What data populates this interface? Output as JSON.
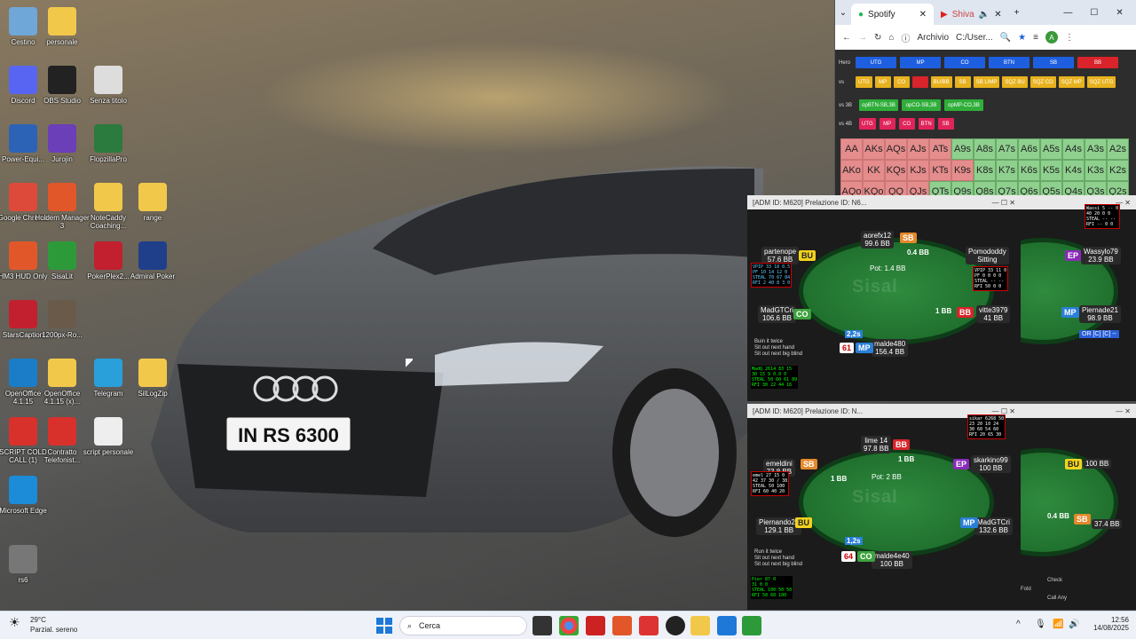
{
  "desktop": {
    "icons": [
      {
        "label": "Cestino",
        "icon": "recycle-bin-icon",
        "color": "#6fa7d8"
      },
      {
        "label": "personale",
        "icon": "folder-icon",
        "color": "#f2c84b"
      },
      {
        "label": "Discord",
        "icon": "discord-icon",
        "color": "#5865f2"
      },
      {
        "label": "OBS Studio",
        "icon": "obs-icon",
        "color": "#222"
      },
      {
        "label": "Senza titolo",
        "icon": "document-icon",
        "color": "#ddd"
      },
      {
        "label": "Power-Equi...",
        "icon": "power-equilab-icon",
        "color": "#2c63b7"
      },
      {
        "label": "Jurojin",
        "icon": "jurojin-icon",
        "color": "#6a3fb7"
      },
      {
        "label": "FlopzillaPro",
        "icon": "flopzilla-icon",
        "color": "#2b7a3e"
      },
      {
        "label": "Google Chrome",
        "icon": "chrome-icon",
        "color": "#dd4a3a"
      },
      {
        "label": "Holdem Manager 3",
        "icon": "holdem-manager-icon",
        "color": "#e2572a"
      },
      {
        "label": "NoteCaddy Coaching...",
        "icon": "folder-icon",
        "color": "#f2c84b"
      },
      {
        "label": "range",
        "icon": "folder-icon",
        "color": "#f2c84b"
      },
      {
        "label": "HM3 HUD Only",
        "icon": "hm3-hud-icon",
        "color": "#e2572a"
      },
      {
        "label": "SisaLit",
        "icon": "sisal-icon",
        "color": "#2d9a3a"
      },
      {
        "label": "PokerPlex2...",
        "icon": "pokerplex-icon",
        "color": "#c21f2f"
      },
      {
        "label": "Admiral Poker",
        "icon": "admiral-poker-icon",
        "color": "#1f3f8a"
      },
      {
        "label": "StarsCaption",
        "icon": "stars-icon",
        "color": "#c21f2f"
      },
      {
        "label": "1200px-Ro...",
        "icon": "image-icon",
        "color": "#6a5a4a"
      },
      {
        "label": "OpenOffice 4.1.15",
        "icon": "openoffice-icon",
        "color": "#1b7dc8"
      },
      {
        "label": "OpenOffice 4.1.15 (x)...",
        "icon": "folder-icon",
        "color": "#f2c84b"
      },
      {
        "label": "Telegram",
        "icon": "telegram-icon",
        "color": "#29a0da"
      },
      {
        "label": "SilLogZip",
        "icon": "folder-icon",
        "color": "#f2c84b"
      },
      {
        "label": "SCRIPT COLD CALL (1)",
        "icon": "pdf-icon",
        "color": "#d8312c"
      },
      {
        "label": "Contratto Telefonist...",
        "icon": "pdf-icon",
        "color": "#d8312c"
      },
      {
        "label": "script personale",
        "icon": "document-icon",
        "color": "#eee"
      },
      {
        "label": "Microsoft Edge",
        "icon": "edge-icon",
        "color": "#1c8bd8"
      },
      {
        "label": "rs6",
        "icon": "car-image-icon",
        "color": "#777"
      }
    ],
    "plate": "IN RS 6300"
  },
  "browser": {
    "tab_active": "Spotify",
    "tab_other": "Shiva",
    "address": "C:/User...",
    "archive_label": "Archivio",
    "rows": {
      "hero": "Hero",
      "vs": "vs",
      "vs3b": "vs 3B",
      "vs4b": "vs 4B",
      "hero_btns": [
        "UTG",
        "MP",
        "CO",
        "BTN",
        "SB",
        "BB"
      ],
      "vs_btns": [
        "UTG",
        "MP",
        "CO",
        "",
        "BU/BB",
        "SB",
        "SB LIMP",
        "SQZ BU",
        "SQZ CO",
        "SQZ MP",
        "SQZ UTG"
      ],
      "vs3b_btns": [
        "opBTN-SB,3B",
        "opCO-SB,3B",
        "opMP-CO,3B"
      ],
      "vs4b_btns": [
        "UTG",
        "MP",
        "CO",
        "BTN",
        "SB"
      ]
    },
    "grid": [
      [
        "AA",
        "AKs",
        "AQs",
        "AJs",
        "ATs",
        "A9s",
        "A8s",
        "A7s",
        "A6s",
        "A5s",
        "A4s",
        "A3s",
        "A2s"
      ],
      [
        "AKo",
        "KK",
        "KQs",
        "KJs",
        "KTs",
        "K9s",
        "K8s",
        "K7s",
        "K6s",
        "K5s",
        "K4s",
        "K3s",
        "K2s"
      ],
      [
        "AQo",
        "KQo",
        "QQ",
        "QJs",
        "QTs",
        "Q9s",
        "Q8s",
        "Q7s",
        "Q6s",
        "Q5s",
        "Q4s",
        "Q3s",
        "Q2s"
      ]
    ]
  },
  "tables": [
    {
      "title": "[ADM ID: M620] Prelazione ID: N6...",
      "pot": "Pot: 1.4 BB",
      "seats": [
        {
          "name": "aorefx12",
          "stack": "99.6 BB",
          "pos": "SB"
        },
        {
          "name": "partenope",
          "stack": "57.6 BB",
          "pos": "BU"
        },
        {
          "name": "Pomododdy",
          "stack": "Sitting"
        },
        {
          "name": "MadGTCri",
          "stack": "106.6 BB",
          "pos": "CO"
        },
        {
          "name": "vitte3979",
          "stack": "41 BB",
          "pos": "BB"
        },
        {
          "name": "malde480",
          "stack": "156.4 BB",
          "pos": "MP"
        }
      ],
      "bet": "0.4 BB",
      "bet2": "1 BB",
      "timer": "61",
      "bb_bet": "2,2s",
      "options": [
        "Buin it twice",
        "Sit out next hand",
        "Sit out next big blind"
      ]
    },
    {
      "title": "[ADM ID: M620] Prelazione ID: N...",
      "pot": "Pot: 2 BB",
      "seats": [
        {
          "name": "lime 14",
          "stack": "97.8 BB",
          "pos": "BB"
        },
        {
          "name": "emeldini",
          "stack": "73.8 BB",
          "pos": "SB"
        },
        {
          "name": "skarkino99",
          "stack": "100 BB",
          "pos": "EP"
        },
        {
          "name": "Piernando20",
          "stack": "129.1 BB",
          "pos": "BU"
        },
        {
          "name": "MadGTCri",
          "stack": "132.6 BB",
          "pos": "MP"
        },
        {
          "name": "malde4e40",
          "stack": "100 BB",
          "pos": "CO"
        }
      ],
      "bet": "1 BB",
      "bet2": "1 BB",
      "timer": "64",
      "bb_bet": "1,2s",
      "options": [
        "Run it twice",
        "Sit out next hand",
        "Sit out next big blind"
      ]
    }
  ],
  "side": {
    "right1_name": "Wassylo79",
    "right1_stack": "23.9 BB",
    "right1_pos": "EP",
    "right2_name": "Piernade21",
    "right2_stack": "98.9 BB",
    "right2_pos": "MP",
    "btn": "OR [C] [C] --",
    "r3_stack": "100 BB",
    "r3_pos": "BU",
    "r4_stack": "37.4 BB",
    "r4_pos": "SB",
    "r4_bet": "0.4 BB",
    "check": "Check",
    "callany": "Call Any",
    "fold": "Fold"
  },
  "taskbar": {
    "weather_temp": "29°C",
    "weather_desc": "Parzial. sereno",
    "search": "Cerca",
    "time": "12:56",
    "date": "14/08/2025"
  }
}
